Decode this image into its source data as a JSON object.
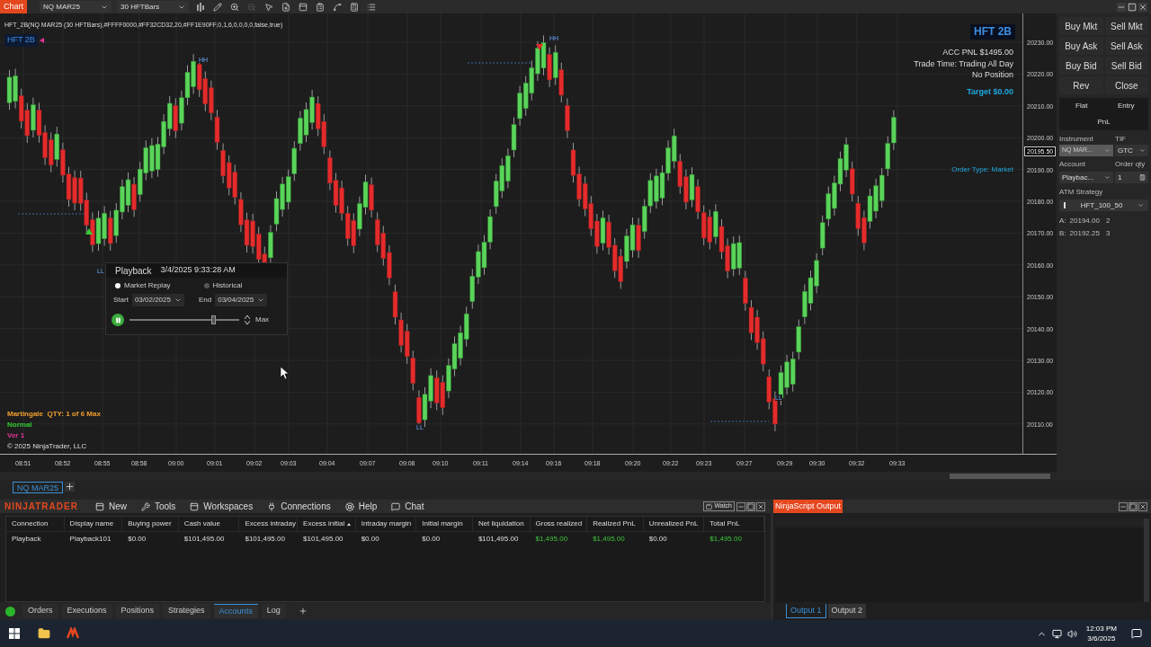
{
  "toolbar": {
    "title": "Chart",
    "instrument": "NQ MAR25",
    "bar_type": "30 HFTBars"
  },
  "chart": {
    "indicator_label": "HFT_2B(NQ MAR25 (30 HFTBars),#FFFF0000,#FF32CD32,20,#FF1E90FF,0,1,6,0,0,0,0,false,true)",
    "badge": "HFT 2B",
    "corner_badge": "HFT 2B",
    "info_lines": [
      "ACC PNL $1495.00",
      "Trade Time: Trading All Day",
      "No Position"
    ],
    "target": "Target $0.00",
    "order_type": "Order Type: Market",
    "status_lines": [
      {
        "text": "Martingale  QTY: 1 of 6 Max",
        "color": "#f0a030"
      },
      {
        "text": "Normal",
        "color": "#33cc33"
      },
      {
        "text": "Ver 1",
        "color": "#e0359b"
      }
    ],
    "copyright": "© 2025 NinjaTrader, LLC",
    "swing_labels": [
      "HH",
      "HH",
      "LL",
      "LL",
      "LL"
    ],
    "price_ticks": [
      "20230.00",
      "20220.00",
      "20210.00",
      "20200.00",
      "20190.00",
      "20180.00",
      "20170.00",
      "20160.00",
      "20150.00",
      "20140.00",
      "20130.00",
      "20120.00",
      "20110.00"
    ],
    "current_price": "20195.50",
    "time_ticks": [
      "08:51",
      "08:52",
      "08:55",
      "08:58",
      "09:00",
      "09:01",
      "09:02",
      "09:03",
      "09:04",
      "09:07",
      "09:08",
      "09:10",
      "09:11",
      "09:14",
      "09:16",
      "09:18",
      "09:20",
      "09:22",
      "09:23",
      "09:27",
      "09:29",
      "09:30",
      "09:32",
      "09:33"
    ]
  },
  "playback": {
    "title": "Playback",
    "timestamp": "3/4/2025 9:33:28 AM",
    "modes": [
      {
        "label": "Market Replay",
        "selected": true
      },
      {
        "label": "Historical",
        "selected": false
      }
    ],
    "start_label": "Start",
    "start": "03/02/2025",
    "end_label": "End",
    "end": "03/04/2025",
    "speed": {
      "level": 0.76
    },
    "speed_label": "Max",
    "playing": true
  },
  "chart_tabs": [
    {
      "label": "NQ MAR25",
      "selected": true
    }
  ],
  "order_panel": {
    "buttons": [
      "Buy Mkt",
      "Sell Mkt",
      "Buy Ask",
      "Sell Ask",
      "Buy Bid",
      "Sell Bid",
      "Rev",
      "Close"
    ],
    "flat": "Flat",
    "entry": "Entry",
    "pnl": "PnL",
    "instrument_label": "Instrument",
    "instrument": "NQ MAR...",
    "instrument_disabled": true,
    "tif_label": "TIF",
    "tif": "GTC",
    "account_label": "Account",
    "account": "Playbac...",
    "qty_label": "Order qty",
    "qty": "1",
    "atm_label": "ATM Strategy",
    "atm": "HFT_100_50",
    "quotes": [
      {
        "label": "A:",
        "price": "20194.00",
        "size": "2"
      },
      {
        "label": "B:",
        "price": "20192.25",
        "size": "3"
      }
    ]
  },
  "control_center": {
    "brand": "NINJATRADER",
    "menu": [
      "New",
      "Tools",
      "Workspaces",
      "Connections",
      "Help",
      "Chat"
    ],
    "watch": "Watch",
    "columns": [
      {
        "label": "Connection"
      },
      {
        "label": "Display name"
      },
      {
        "label": "Buying power"
      },
      {
        "label": "Cash value"
      },
      {
        "label": "Excess intraday"
      },
      {
        "label": "Excess initial",
        "sorted": true
      },
      {
        "label": "Intraday margin"
      },
      {
        "label": "Initial margin"
      },
      {
        "label": "Net liquidation"
      },
      {
        "label": "Gross realized"
      },
      {
        "label": "Realized PnL"
      },
      {
        "label": "Unrealized PnL"
      },
      {
        "label": "Total PnL"
      }
    ],
    "rows": [
      [
        {
          "text": "Playback",
          "kind": "plain"
        },
        {
          "text": "Playback101",
          "kind": "plain"
        },
        {
          "text": "$0.00",
          "kind": "plain"
        },
        {
          "text": "$101,495.00",
          "kind": "plain"
        },
        {
          "text": "$101,495.00",
          "kind": "plain"
        },
        {
          "text": "$101,495.00",
          "kind": "plain"
        },
        {
          "text": "$0.00",
          "kind": "plain"
        },
        {
          "text": "$0.00",
          "kind": "plain"
        },
        {
          "text": "$101,495.00",
          "kind": "plain"
        },
        {
          "text": "$1,495.00",
          "kind": "gain"
        },
        {
          "text": "$1,495.00",
          "kind": "gain"
        },
        {
          "text": "$0.00",
          "kind": "plain"
        },
        {
          "text": "$1,495.00",
          "kind": "gain"
        }
      ]
    ],
    "tabs": [
      {
        "label": "Orders",
        "selected": false
      },
      {
        "label": "Executions",
        "selected": false
      },
      {
        "label": "Positions",
        "selected": false
      },
      {
        "label": "Strategies",
        "selected": false
      },
      {
        "label": "Accounts",
        "selected": true
      },
      {
        "label": "Log",
        "selected": false
      }
    ]
  },
  "output": {
    "title": "NinjaScript Output",
    "tabs": [
      {
        "label": "Output 1",
        "selected": true
      },
      {
        "label": "Output 2",
        "selected": false
      }
    ]
  },
  "taskbar": {
    "time": "12:03 PM",
    "date": "3/6/2025"
  }
}
